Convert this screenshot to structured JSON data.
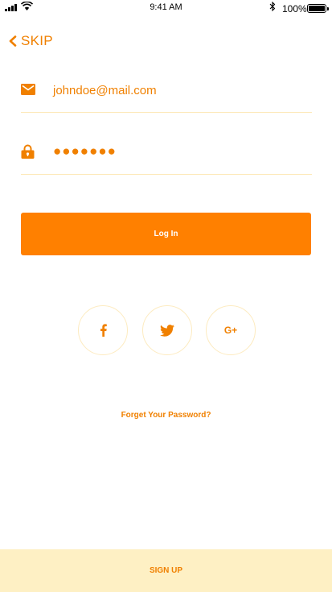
{
  "status_bar": {
    "time": "9:41 AM",
    "battery": "100%"
  },
  "header": {
    "skip_label": "SKIP",
    "skip_icon": "chevron-left-icon"
  },
  "form": {
    "email": {
      "icon": "envelope-icon",
      "value": "johndoe@mail.com"
    },
    "password": {
      "icon": "lock-icon",
      "value": "●●●●●●●"
    },
    "login_label": "Log In"
  },
  "social": [
    {
      "name": "facebook",
      "icon": "facebook-icon"
    },
    {
      "name": "twitter",
      "icon": "twitter-icon"
    },
    {
      "name": "google-plus",
      "icon": "google-plus-icon",
      "label": "G+"
    }
  ],
  "links": {
    "forgot_password": "Forget Your Password?"
  },
  "footer": {
    "signup_label": "SIGN UP"
  },
  "colors": {
    "accent": "#ff8000",
    "accent_text": "#f08000",
    "footer_bg": "#fef0c4",
    "divider": "#fde9b8"
  }
}
